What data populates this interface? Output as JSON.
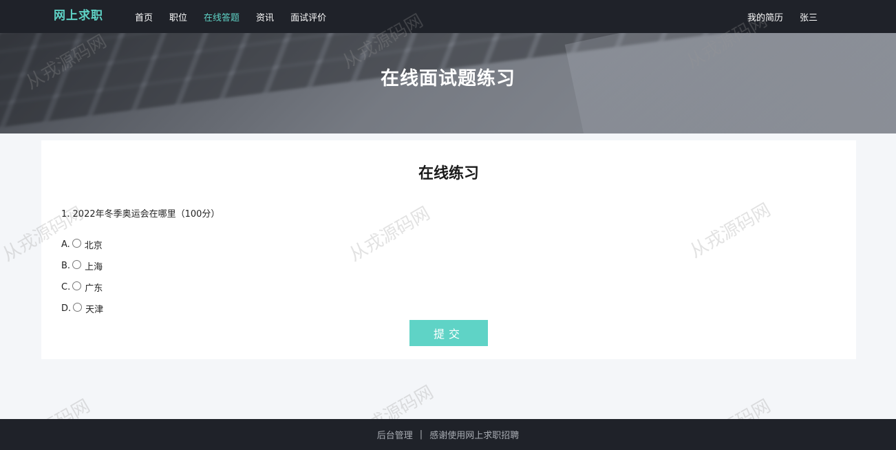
{
  "nav": {
    "brand": "网上求职",
    "menu": [
      {
        "label": "首页",
        "active": false
      },
      {
        "label": "职位",
        "active": false
      },
      {
        "label": "在线答题",
        "active": true
      },
      {
        "label": "资讯",
        "active": false
      },
      {
        "label": "面试评价",
        "active": false
      }
    ],
    "right": {
      "resume": "我的简历",
      "user": "张三"
    }
  },
  "banner": {
    "title": "在线面试题练习"
  },
  "practice": {
    "title": "在线练习",
    "question": "1. 2022年冬季奥运会在哪里（100分）",
    "options": [
      {
        "letter": "A.",
        "text": "北京"
      },
      {
        "letter": "B.",
        "text": "上海"
      },
      {
        "letter": "C.",
        "text": "广东"
      },
      {
        "letter": "D.",
        "text": "天津"
      }
    ],
    "submit_label": "提交"
  },
  "watermark": "从戎源码网",
  "footer": {
    "admin_link": "后台管理",
    "separator": "|",
    "thanks": "感谢使用网上求职招聘"
  },
  "colors": {
    "accent": "#5fd3c6",
    "nav_bg": "#1f2229",
    "page_bg": "#f4f6f9"
  }
}
